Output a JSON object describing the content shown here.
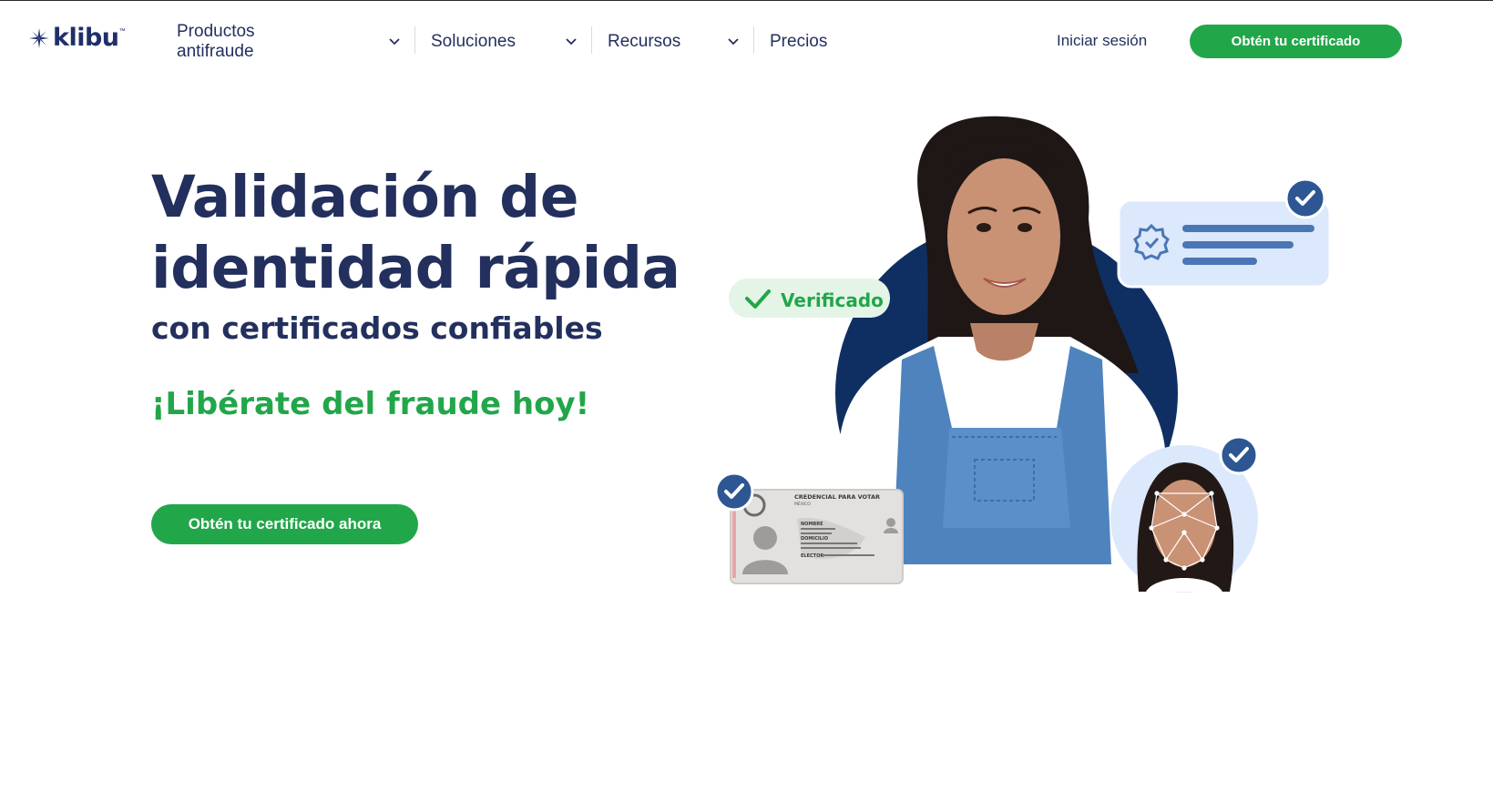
{
  "brand": {
    "name": "klibu",
    "tm": "™"
  },
  "nav": {
    "items": [
      {
        "label": "Productos antifraude",
        "has_dropdown": true
      },
      {
        "label": "Soluciones",
        "has_dropdown": true
      },
      {
        "label": "Recursos",
        "has_dropdown": true
      },
      {
        "label": "Precios",
        "has_dropdown": false
      }
    ],
    "login_label": "Iniciar sesión",
    "cta_label": "Obtén tu certificado"
  },
  "hero": {
    "title": "Validación de identidad rápida",
    "subtitle": "con certificados confiables",
    "slogan": "¡Libérate del fraude hoy!",
    "cta_label": "Obtén tu certificado ahora"
  },
  "illustration": {
    "verified_badge": "Verificado",
    "id_card": {
      "title": "CREDENCIAL PARA VOTAR",
      "country": "MÉXICO",
      "fields": [
        "NOMBRE",
        "DOMICILIO",
        "ELECTOR"
      ]
    }
  },
  "colors": {
    "primary_navy": "#23305e",
    "accent_green": "#22a64a",
    "circle_navy": "#0f2f62",
    "card_blue": "#dce8fb",
    "check_blue": "#2d5693"
  },
  "icons": [
    "chevron-down-icon",
    "check-icon",
    "verified-seal-icon",
    "check-badge-icon",
    "user-silhouette-icon"
  ]
}
